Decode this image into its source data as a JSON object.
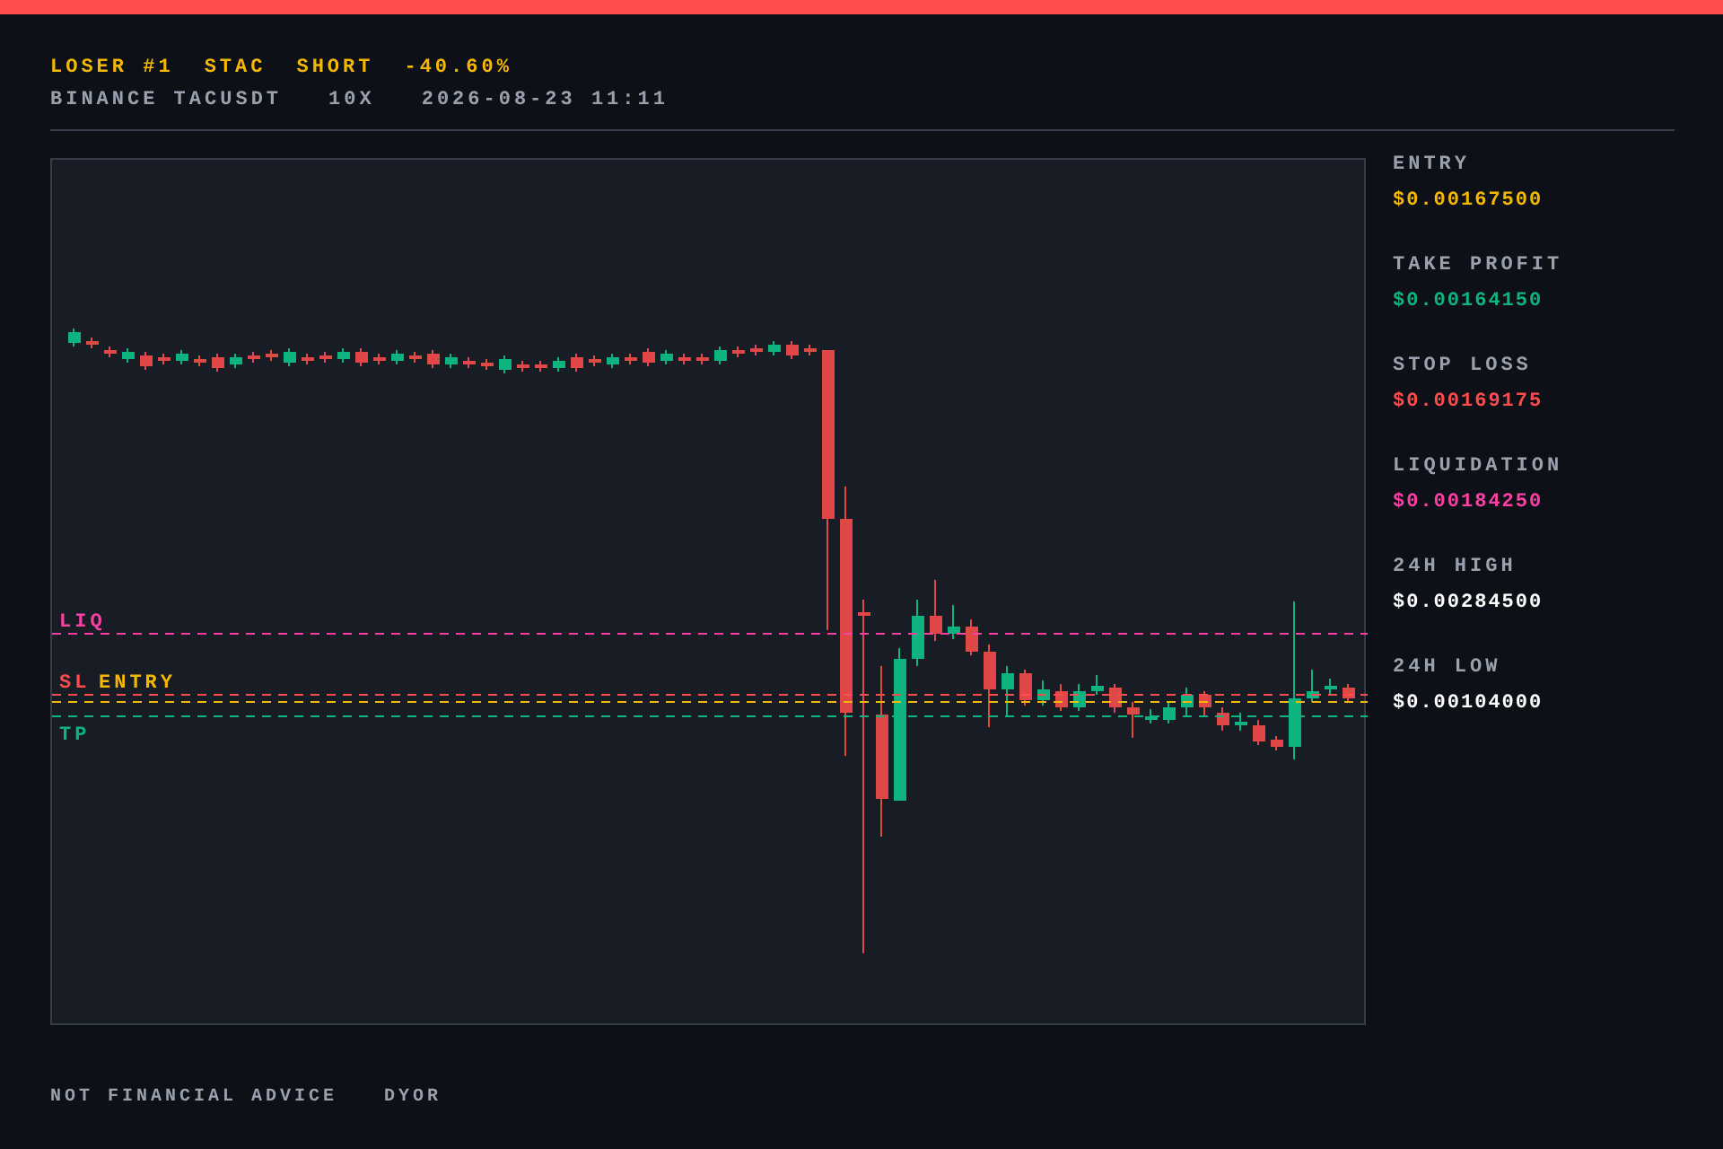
{
  "header": {
    "title_parts": [
      "LOSER #1",
      "STAC",
      "SHORT",
      "-40.60%"
    ],
    "subtitle_parts": [
      "BINANCE TACUSDT",
      "10X",
      "2026-08-23 11:11"
    ]
  },
  "chart": {
    "price_lines": [
      {
        "label": "LIQ",
        "color": "#ff3fa4"
      },
      {
        "label": "SL",
        "color": "#ff4d4d"
      },
      {
        "label": "ENTRY",
        "color": "#f5b800"
      },
      {
        "label": "TP",
        "color": "#0fb37f"
      }
    ]
  },
  "stats": [
    {
      "label": "ENTRY",
      "value": "$0.00167500",
      "color": "#f5b800"
    },
    {
      "label": "TAKE PROFIT",
      "value": "$0.00164150",
      "color": "#0fb37f"
    },
    {
      "label": "STOP LOSS",
      "value": "$0.00169175",
      "color": "#ff4d4d"
    },
    {
      "label": "LIQUIDATION",
      "value": "$0.00184250",
      "color": "#ff3fa4"
    },
    {
      "label": "24H HIGH",
      "value": "$0.00284500",
      "color": "#ffffff"
    },
    {
      "label": "24H LOW",
      "value": "$0.00104000",
      "color": "#ffffff"
    }
  ],
  "footer": {
    "parts": [
      "NOT FINANCIAL ADVICE",
      "DYOR"
    ]
  }
}
